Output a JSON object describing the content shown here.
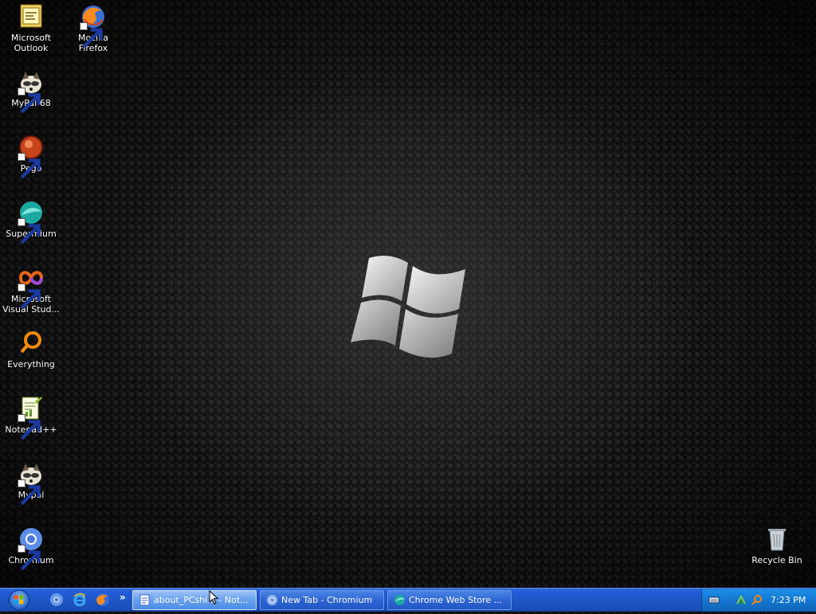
{
  "desktop": {
    "icons": [
      {
        "label": "Microsoft\nOutlook",
        "icon": "outlook-icon"
      },
      {
        "label": "Mozilla\nFirefox",
        "icon": "firefox-icon"
      },
      {
        "label": "MyPal 68",
        "icon": "mypal-icon"
      },
      {
        "label": "Pego",
        "icon": "pego-icon"
      },
      {
        "label": "Supermium",
        "icon": "supermium-icon"
      },
      {
        "label": "Microsoft\nVisual Stud...",
        "icon": "visual-studio-icon"
      },
      {
        "label": "Everything",
        "icon": "everything-icon"
      },
      {
        "label": "Notepad++",
        "icon": "notepadpp-icon"
      },
      {
        "label": "Mypal",
        "icon": "mypal-icon"
      },
      {
        "label": "Chromium",
        "icon": "chromium-icon"
      },
      {
        "label": "Recycle Bin",
        "icon": "recycle-bin-icon"
      }
    ]
  },
  "taskbar": {
    "start_label": "Start",
    "quick_launch": [
      "chromium-icon",
      "internet-explorer-icon",
      "firefox-icon"
    ],
    "overflow": "»",
    "tasks": [
      {
        "title": "about_PCshi... - Not...",
        "active": true,
        "icon": "notepad-icon"
      },
      {
        "title": "New Tab - Chromium",
        "active": false,
        "icon": "chromium-icon"
      },
      {
        "title": "Chrome Web Store ...",
        "active": false,
        "icon": "supermium-icon"
      }
    ],
    "tray": {
      "icons": [
        "keyboard-icon",
        "network-icon",
        "search-icon"
      ],
      "clock": "7:23 PM"
    }
  },
  "colors": {
    "taskbar_blue": "#245edb",
    "tray_blue": "#1477d1",
    "desktop_bg": "#111111"
  }
}
